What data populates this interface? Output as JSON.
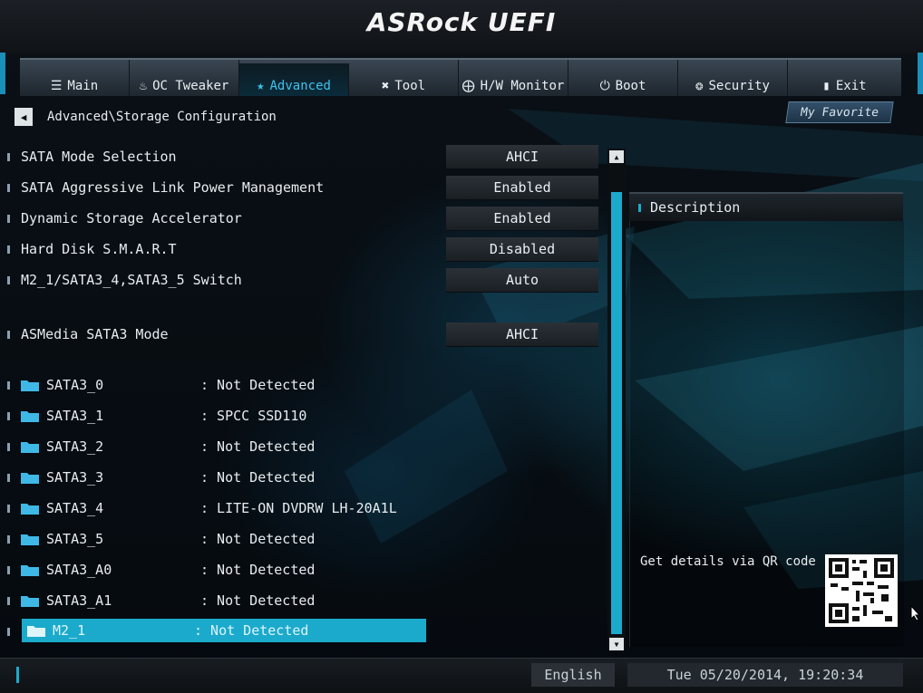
{
  "app": {
    "logo": "ASRock UEFI"
  },
  "colors": {
    "accent": "#1baacc",
    "tab_active_text": "#3fc2ec"
  },
  "nav": {
    "tabs": [
      {
        "label": "Main",
        "icon": "list-icon"
      },
      {
        "label": "OC Tweaker",
        "icon": "flame-icon"
      },
      {
        "label": "Advanced",
        "icon": "star-icon",
        "active": true
      },
      {
        "label": "Tool",
        "icon": "tools-icon"
      },
      {
        "label": "H/W Monitor",
        "icon": "monitor-icon"
      },
      {
        "label": "Boot",
        "icon": "power-icon"
      },
      {
        "label": "Security",
        "icon": "shield-icon"
      },
      {
        "label": "Exit",
        "icon": "exit-icon"
      }
    ]
  },
  "breadcrumb": {
    "path": "Advanced\\Storage Configuration"
  },
  "favorite": {
    "label": "My Favorite"
  },
  "settings": [
    {
      "label": "SATA Mode Selection",
      "value": "AHCI"
    },
    {
      "label": "SATA Aggressive Link Power Management",
      "value": "Enabled"
    },
    {
      "label": "Dynamic Storage Accelerator",
      "value": "Enabled"
    },
    {
      "label": "Hard Disk S.M.A.R.T",
      "value": "Disabled"
    },
    {
      "label": "M2_1/SATA3_4,SATA3_5 Switch",
      "value": "Auto"
    },
    {
      "label": "ASMedia SATA3 Mode",
      "value": "AHCI"
    }
  ],
  "devices": [
    {
      "name": "SATA3_0",
      "status": ": Not Detected"
    },
    {
      "name": "SATA3_1",
      "status": ": SPCC SSD110"
    },
    {
      "name": "SATA3_2",
      "status": ": Not Detected"
    },
    {
      "name": "SATA3_3",
      "status": ": Not Detected"
    },
    {
      "name": "SATA3_4",
      "status": ": LITE-ON DVDRW LH-20A1L"
    },
    {
      "name": "SATA3_5",
      "status": ": Not Detected"
    },
    {
      "name": "SATA3_A0",
      "status": ": Not Detected"
    },
    {
      "name": "SATA3_A1",
      "status": ": Not Detected"
    },
    {
      "name": "M2_1",
      "status": ": Not Detected",
      "selected": true
    }
  ],
  "description": {
    "title": "Description",
    "qr_text": "Get details via QR code"
  },
  "footer": {
    "language": "English",
    "datetime": "Tue 05/20/2014, 19:20:34"
  }
}
